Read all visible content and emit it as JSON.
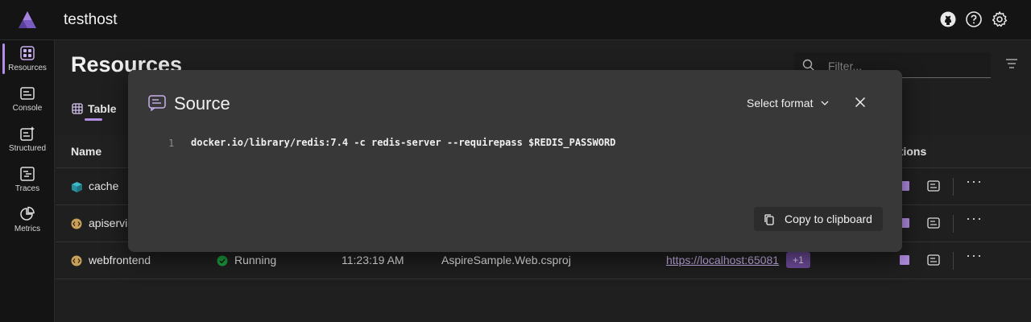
{
  "app": {
    "title": "testhost"
  },
  "colors": {
    "accent": "#b48ee6",
    "running": "#1b9e3e",
    "dialog_bg": "#383838"
  },
  "header_icons": [
    "github-icon",
    "help-icon",
    "settings-icon"
  ],
  "nav": [
    {
      "label": "Resources",
      "icon": "resources-icon",
      "active": true
    },
    {
      "label": "Console",
      "icon": "console-icon"
    },
    {
      "label": "Structured",
      "icon": "structured-icon"
    },
    {
      "label": "Traces",
      "icon": "traces-icon"
    },
    {
      "label": "Metrics",
      "icon": "metrics-icon"
    }
  ],
  "page": {
    "title": "Resources",
    "filter_placeholder": "Filter...",
    "tab_table": "Table",
    "col_name": "Name",
    "col_actions": "ctions"
  },
  "rows": [
    {
      "name": "cache",
      "icon": "container-icon"
    },
    {
      "name": "apiservic",
      "icon": "project-icon"
    },
    {
      "name": "webfrontend",
      "icon": "project-icon",
      "state": "Running",
      "start": "11:23:19 AM",
      "source": "AspireSample.Web.csproj",
      "url": "https://localhost:65081",
      "badge": "+1"
    }
  ],
  "dialog": {
    "title": "Source",
    "format_label": "Select format",
    "line_number": "1",
    "code": "docker.io/library/redis:7.4 -c redis-server --requirepass $REDIS_PASSWORD",
    "copy_label": "Copy to clipboard"
  }
}
